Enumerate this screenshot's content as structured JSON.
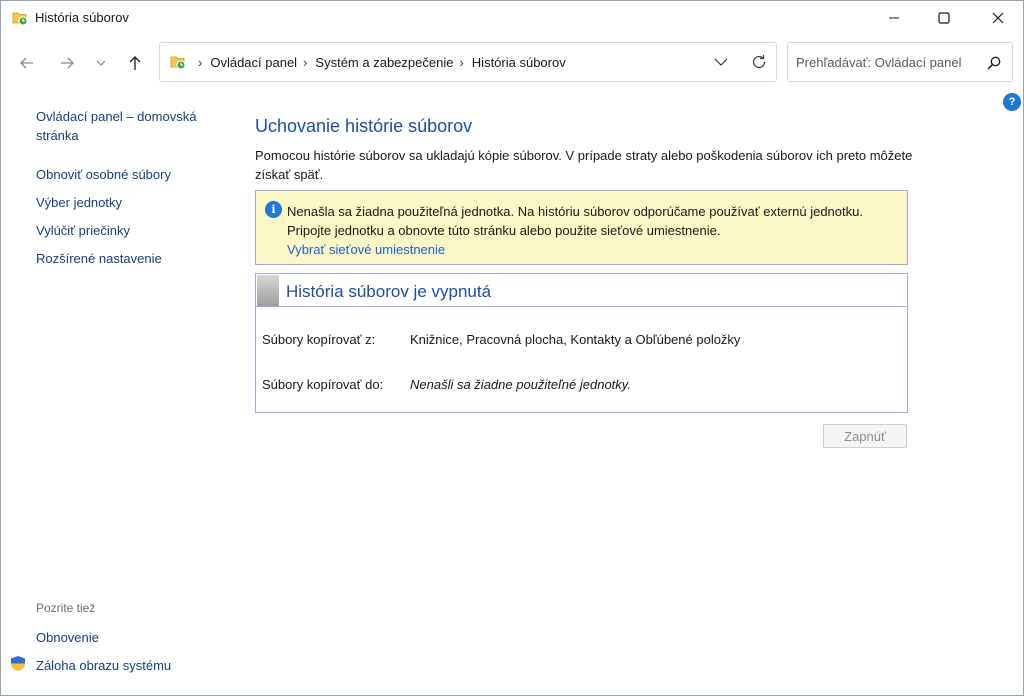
{
  "window": {
    "title": "História súborov"
  },
  "address": {
    "crumbs": [
      "Ovládací panel",
      "Systém a zabezpečenie",
      "História súborov"
    ]
  },
  "search": {
    "placeholder": "Prehľadávať: Ovládací panel"
  },
  "sidebar": {
    "home": "Ovládací panel – domovská stránka",
    "items": [
      "Obnoviť osobné súbory",
      "Výber jednotky",
      "Vylúčiť priečinky",
      "Rozšírené nastavenie"
    ],
    "see_also_label": "Pozrite tiež",
    "see_also_items": [
      "Obnovenie",
      "Záloha obrazu systému"
    ]
  },
  "main": {
    "title": "Uchovanie histórie súborov",
    "description": "Pomocou histórie súborov sa ukladajú kópie súborov. V prípade straty alebo poškodenia súborov ich preto môžete získať späť.",
    "info": {
      "text": "Nenašla sa žiadna použiteľná jednotka. Na históriu súborov odporúčame používať externú jednotku. Pripojte jednotku a obnovte túto stránku alebo použite sieťové umiestnenie.",
      "link": "Vybrať sieťové umiestnenie"
    },
    "status": {
      "title": "História súborov je vypnutá",
      "copy_from_label": "Súbory kopírovať z:",
      "copy_from_value": "Knižnice, Pracovná plocha, Kontakty a Obľúbené položky",
      "copy_to_label": "Súbory kopírovať do:",
      "copy_to_value": "Nenašli sa žiadne použiteľné jednotky."
    },
    "enable_button": "Zapnúť"
  },
  "colors": {
    "accent": "#1e4fa0",
    "link": "#1e64c8",
    "info_bg": "#fbf7c7",
    "border": "#a7a9d6"
  },
  "icons": {
    "title": "file-history-icon",
    "minimize": "minimize-icon",
    "maximize": "maximize-icon",
    "close": "close-icon",
    "back": "back-arrow-icon",
    "forward": "forward-arrow-icon",
    "recent": "chevron-down-icon",
    "up": "up-arrow-icon",
    "refresh": "refresh-icon",
    "search": "search-icon",
    "help": "help-icon",
    "info": "info-icon",
    "shield": "shield-icon"
  }
}
